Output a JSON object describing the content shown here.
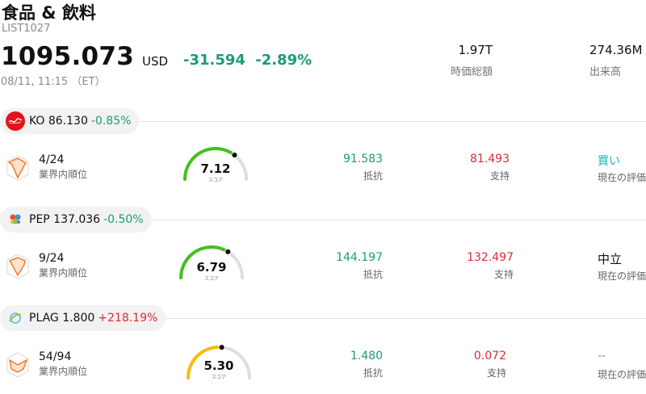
{
  "header": {
    "title": "食品 & 飲料",
    "list_id": "LIST1027",
    "price": "1095.073",
    "currency": "USD",
    "change": "-31.594",
    "change_pct": "-2.89%",
    "timestamp": "08/11, 11:15 （ET）",
    "market_cap_value": "1.97T",
    "market_cap_label": "時価総額",
    "volume_value": "274.36M",
    "volume_label": "出来高"
  },
  "colors": {
    "negative": "#1a9c7a",
    "positive": "#e0293a",
    "buy": "#1cb0b0"
  },
  "stocks": [
    {
      "ticker_price": "KO 86.130",
      "change_pct": "-0.85%",
      "logo_icon": "coca-cola-logo-icon",
      "rank": "4/24",
      "rank_label": "業界内順位",
      "score": "7.12",
      "score_value": 7.12,
      "score_label": "スコア",
      "resistance": "91.583",
      "resistance_label": "抵抗",
      "support": "81.493",
      "support_label": "支持",
      "evaluation": "買い",
      "evaluation_label": "現在の評価"
    },
    {
      "ticker_price": "PEP 137.036",
      "change_pct": "-0.50%",
      "logo_icon": "pepsico-logo-icon",
      "rank": "9/24",
      "rank_label": "業界内順位",
      "score": "6.79",
      "score_value": 6.79,
      "score_label": "スコア",
      "resistance": "144.197",
      "resistance_label": "抵抗",
      "support": "132.497",
      "support_label": "支持",
      "evaluation": "中立",
      "evaluation_label": "現在の評価"
    },
    {
      "ticker_price": "PLAG 1.800",
      "change_pct": "+218.19%",
      "logo_icon": "planet-green-logo-icon",
      "rank": "54/94",
      "rank_label": "業界内順位",
      "score": "5.30",
      "score_value": 5.3,
      "score_label": "スコア",
      "resistance": "1.480",
      "resistance_label": "抵抗",
      "support": "0.072",
      "support_label": "支持",
      "evaluation": "--",
      "evaluation_label": "現在の評価"
    }
  ]
}
